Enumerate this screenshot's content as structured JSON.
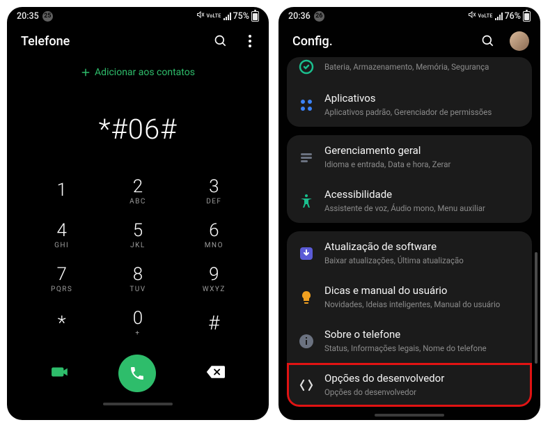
{
  "phoneA": {
    "status": {
      "time": "20:35",
      "badge": "25",
      "lte": "VoLTE",
      "battery": "75%"
    },
    "title": "Telefone",
    "add_contact": "Adicionar aos contatos",
    "dialed": "*#06#",
    "keys": [
      {
        "d": "1",
        "s": ""
      },
      {
        "d": "2",
        "s": "ABC"
      },
      {
        "d": "3",
        "s": "DEF"
      },
      {
        "d": "4",
        "s": "GHI"
      },
      {
        "d": "5",
        "s": "JKL"
      },
      {
        "d": "6",
        "s": "MNO"
      },
      {
        "d": "7",
        "s": "PQRS"
      },
      {
        "d": "8",
        "s": "TUV"
      },
      {
        "d": "9",
        "s": "WXYZ"
      },
      {
        "d": "*",
        "s": ""
      },
      {
        "d": "0",
        "s": "+"
      },
      {
        "d": "#",
        "s": ""
      }
    ]
  },
  "phoneB": {
    "status": {
      "time": "20:36",
      "badge": "26",
      "lte": "VoLTE",
      "battery": "76%"
    },
    "title": "Config.",
    "items": {
      "care": {
        "title": "",
        "sub": "Bateria, Armazenamento, Memória, Segurança"
      },
      "apps": {
        "title": "Aplicativos",
        "sub": "Aplicativos padrão, Gerenciador de permissões"
      },
      "general": {
        "title": "Gerenciamento geral",
        "sub": "Idioma e entrada, Data e hora, Zerar"
      },
      "access": {
        "title": "Acessibilidade",
        "sub": "Assistente de voz, Áudio mono, Menu auxiliar"
      },
      "update": {
        "title": "Atualização de software",
        "sub": "Baixar atualizações, Última atualização"
      },
      "tips": {
        "title": "Dicas e manual do usuário",
        "sub": "Novidades, Ideias inteligentes, Manual do usuário"
      },
      "about": {
        "title": "Sobre o telefone",
        "sub": "Status, Informações legais, Nome do telefone"
      },
      "dev": {
        "title": "Opções do desenvolvedor",
        "sub": "Opções do desenvolvedor"
      }
    }
  }
}
